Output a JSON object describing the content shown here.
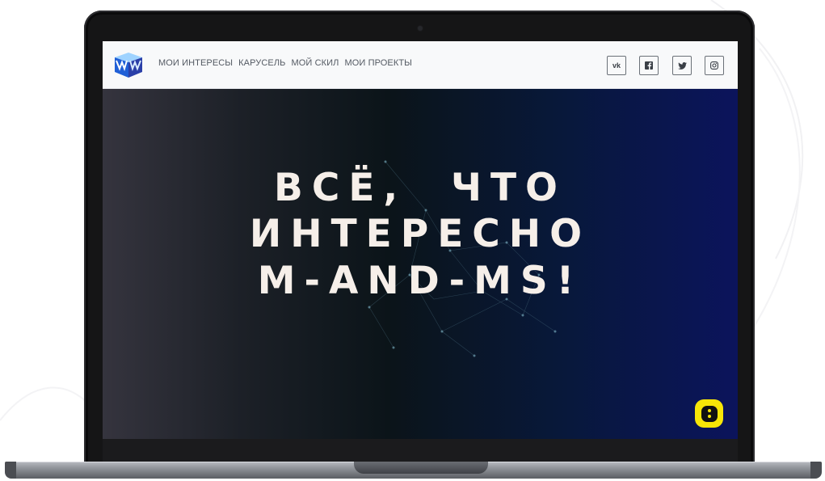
{
  "nav": {
    "logo_icon": "mms-logo-icon",
    "links": [
      "МОИ ИНТЕРЕСЫ",
      "КАРУСЕЛЬ",
      "МОЙ СКИЛ",
      "МОИ ПРОЕКТЫ"
    ],
    "social": [
      {
        "icon": "vk-icon",
        "label": "vk"
      },
      {
        "icon": "facebook-icon",
        "label": "f"
      },
      {
        "icon": "twitter-icon",
        "label": ""
      },
      {
        "icon": "instagram-icon",
        "label": ""
      }
    ]
  },
  "hero": {
    "lines": [
      "ВСЁ,  ЧТО",
      "ИНТЕРЕСНО",
      "M-AND-MS!"
    ]
  },
  "fab": {
    "icon": "chat-assistant-icon"
  },
  "colors": {
    "nav_bg": "#f8f9fa",
    "hero_left": "#35343e",
    "hero_right": "#0b145c",
    "headline": "#f6efe9",
    "fab": "#f7e607"
  }
}
